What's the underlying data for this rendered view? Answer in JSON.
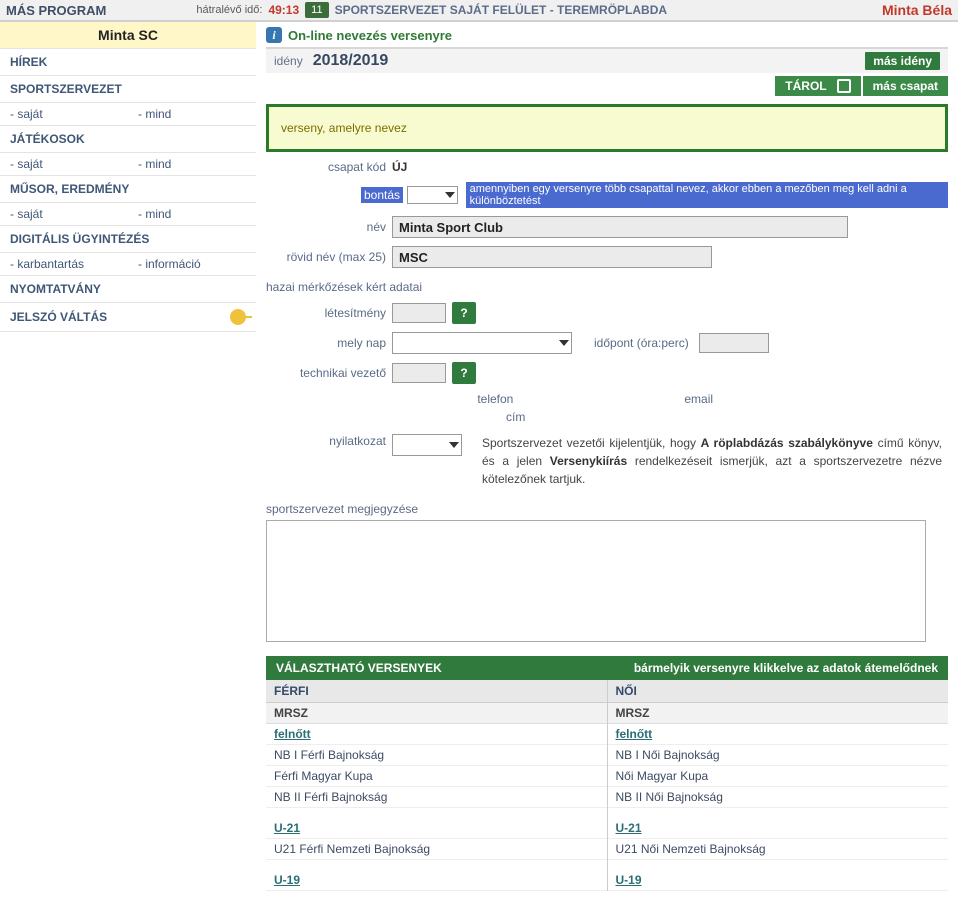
{
  "top": {
    "program": "MÁS PROGRAM",
    "remain_label": "hátralévő idő:",
    "remain_time": "49:13",
    "badge": "11",
    "breadcrumb": "SPORTSZERVEZET SAJÁT FELÜLET - TEREMRÖPLABDA",
    "user": "Minta Béla"
  },
  "sidebar": {
    "org": "Minta SC",
    "items": {
      "hirek": "HÍREK",
      "sportszervezet": "SPORTSZERVEZET",
      "jatekosok": "JÁTÉKOSOK",
      "musor": "MŰSOR, EREDMÉNY",
      "digitalis": "DIGITÁLIS ÜGYINTÉZÉS",
      "nyomtatvany": "NYOMTATVÁNY",
      "jelszo": "JELSZÓ VÁLTÁS"
    },
    "sub": {
      "sajat": "- saját",
      "mind": "- mind",
      "karb": "- karbantartás",
      "info": "- információ"
    }
  },
  "page": {
    "title": "On-line nevezés versenyre",
    "season_label": "idény",
    "season": "2018/2019",
    "more_season": "más idény",
    "save": "TÁROL",
    "other_team": "más csapat",
    "yellow": "verseny, amelyre nevez",
    "team_code_label": "csapat kód",
    "team_code": "ÚJ",
    "split_label": "bontás",
    "split_hint": "amennyiben egy versenyre több csapattal nevez, akkor ebben a mezőben meg kell adni a különböztetést",
    "name_label": "név",
    "name": "Minta Sport Club",
    "short_label": "rövid név (max 25)",
    "short": "MSC",
    "homematch_header": "hazai mérkőzések kért adatai",
    "facility_label": "létesítmény",
    "day_label": "mely nap",
    "time_label": "időpont (óra:perc)",
    "tech_label": "technikai vezető",
    "phone": "telefon",
    "email": "email",
    "cim": "cím",
    "declare_label": "nyilatkozat",
    "declare_text_pre": "Sportszervezet vezetői kijelentjük, hogy ",
    "declare_text_bold1": "A röplabdázás szabálykönyve",
    "declare_text_mid": " című könyv, és a jelen ",
    "declare_text_bold2": "Versenykiírás",
    "declare_text_post": " rendelkezéseit ismerjük, azt a sportszervezetre nézve kötelezőnek tartjuk.",
    "note_label": "sportszervezet megjegyzése"
  },
  "comp": {
    "header": "VÁLASZTHATÓ VERSENYEK",
    "hint": "bármelyik versenyre klikkelve az adatok átemelődnek",
    "col_m": "FÉRFI",
    "col_f": "NŐI",
    "org": "MRSZ",
    "cat_adult": "felnőtt",
    "m": {
      "adult": [
        "NB I Férfi Bajnokság",
        "Férfi Magyar Kupa",
        "NB II Férfi Bajnokság"
      ],
      "u21_cat": "U-21",
      "u21": [
        "U21 Férfi Nemzeti Bajnokság"
      ],
      "u19_cat": "U-19"
    },
    "f": {
      "adult": [
        "NB I Női Bajnokság",
        "Női Magyar Kupa",
        "NB II Női Bajnokság"
      ],
      "u21_cat": "U-21",
      "u21": [
        "U21 Női Nemzeti Bajnokság"
      ],
      "u19_cat": "U-19"
    }
  }
}
